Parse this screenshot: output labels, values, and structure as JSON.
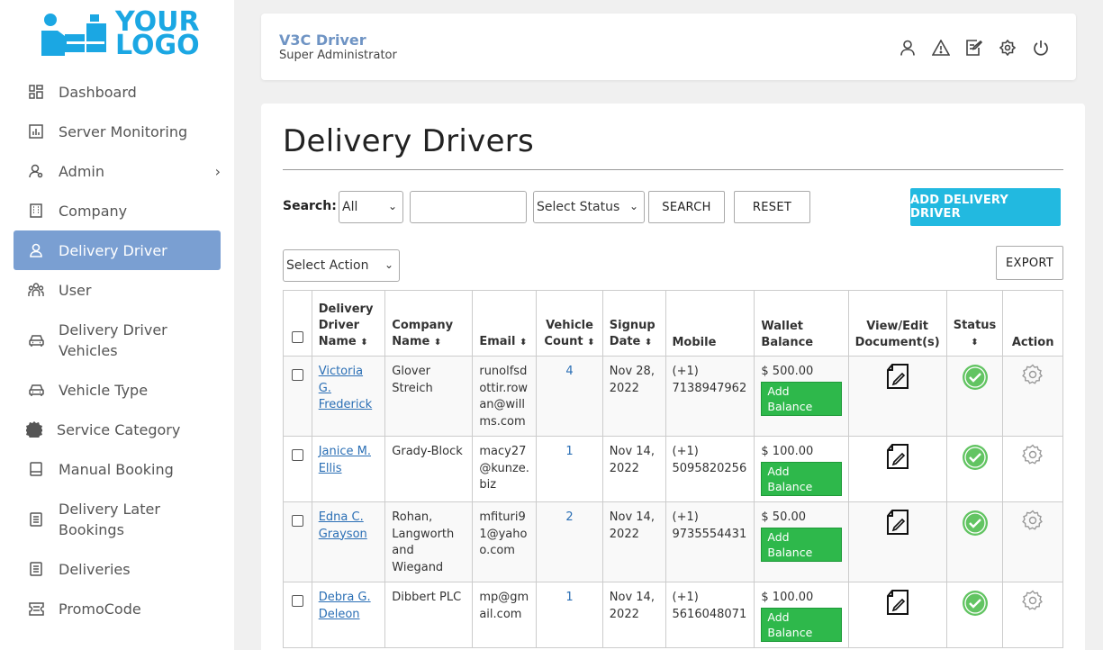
{
  "logo": {
    "line1": "YOUR",
    "line2": "LOGO",
    "color": "#1ba7e3"
  },
  "sidebar": {
    "items": [
      {
        "label": "Dashboard",
        "icon": "dashboard-icon"
      },
      {
        "label": "Server Monitoring",
        "icon": "chart-icon"
      },
      {
        "label": "Admin",
        "icon": "admin-user-icon"
      },
      {
        "label": "Company",
        "icon": "building-icon"
      },
      {
        "label": "Delivery Driver",
        "icon": "driver-icon"
      },
      {
        "label": "User",
        "icon": "users-icon"
      },
      {
        "label": "Delivery Driver Vehicles",
        "icon": "car-icon"
      },
      {
        "label": "Vehicle Type",
        "icon": "car-icon"
      },
      {
        "label": "Service Category",
        "icon": "cog-badge-icon"
      },
      {
        "label": "Manual Booking",
        "icon": "booking-icon"
      },
      {
        "label": "Delivery Later Bookings",
        "icon": "list-icon"
      },
      {
        "label": "Deliveries",
        "icon": "list-icon"
      },
      {
        "label": "PromoCode",
        "icon": "ticket-icon"
      }
    ],
    "active_color": "#7a9fd2"
  },
  "header": {
    "title": "V3C Driver",
    "subtitle": "Super Administrator"
  },
  "main": {
    "title": "Delivery Drivers",
    "search_label": "Search:",
    "filter_all": "All",
    "search_placeholder": "",
    "status_select": "Select Status",
    "search_button": "SEARCH",
    "reset_button": "RESET",
    "add_button": "ADD DELIVERY DRIVER",
    "action_select": "Select Action",
    "export_button": "EXPORT"
  },
  "table": {
    "headers": {
      "name": "Delivery Driver Name",
      "company": "Company Name",
      "email": "Email",
      "vehicle_count": "Vehicle Count",
      "signup": "Signup Date",
      "mobile": "Mobile",
      "wallet": "Wallet Balance",
      "docs": "View/Edit Document(s)",
      "status": "Status",
      "action": "Action"
    },
    "add_balance_label": "Add Balance",
    "rows": [
      {
        "name": "Victoria G. Frederick",
        "company": "Glover Streich",
        "email": "runolfsdottir.rowan@willms.com",
        "vehicles": "4",
        "signup": "Nov 28, 2022",
        "mobile": "(+1) 7138947962",
        "wallet": "$ 500.00"
      },
      {
        "name": "Janice M. Ellis",
        "company": "Grady-Block",
        "email": "macy27@kunze.biz",
        "vehicles": "1",
        "signup": "Nov 14, 2022",
        "mobile": "(+1) 5095820256",
        "wallet": "$ 100.00"
      },
      {
        "name": "Edna C. Grayson",
        "company": "Rohan, Langworth and Wiegand",
        "email": "mfituri91@yahoo.com",
        "vehicles": "2",
        "signup": "Nov 14, 2022",
        "mobile": "(+1) 9735554431",
        "wallet": "$ 50.00"
      },
      {
        "name": "Debra G. Deleon",
        "company": "Dibbert PLC",
        "email": "mp@gmail.com",
        "vehicles": "1",
        "signup": "Nov 14, 2022",
        "mobile": "(+1) 5616048071",
        "wallet": "$ 100.00"
      }
    ]
  }
}
